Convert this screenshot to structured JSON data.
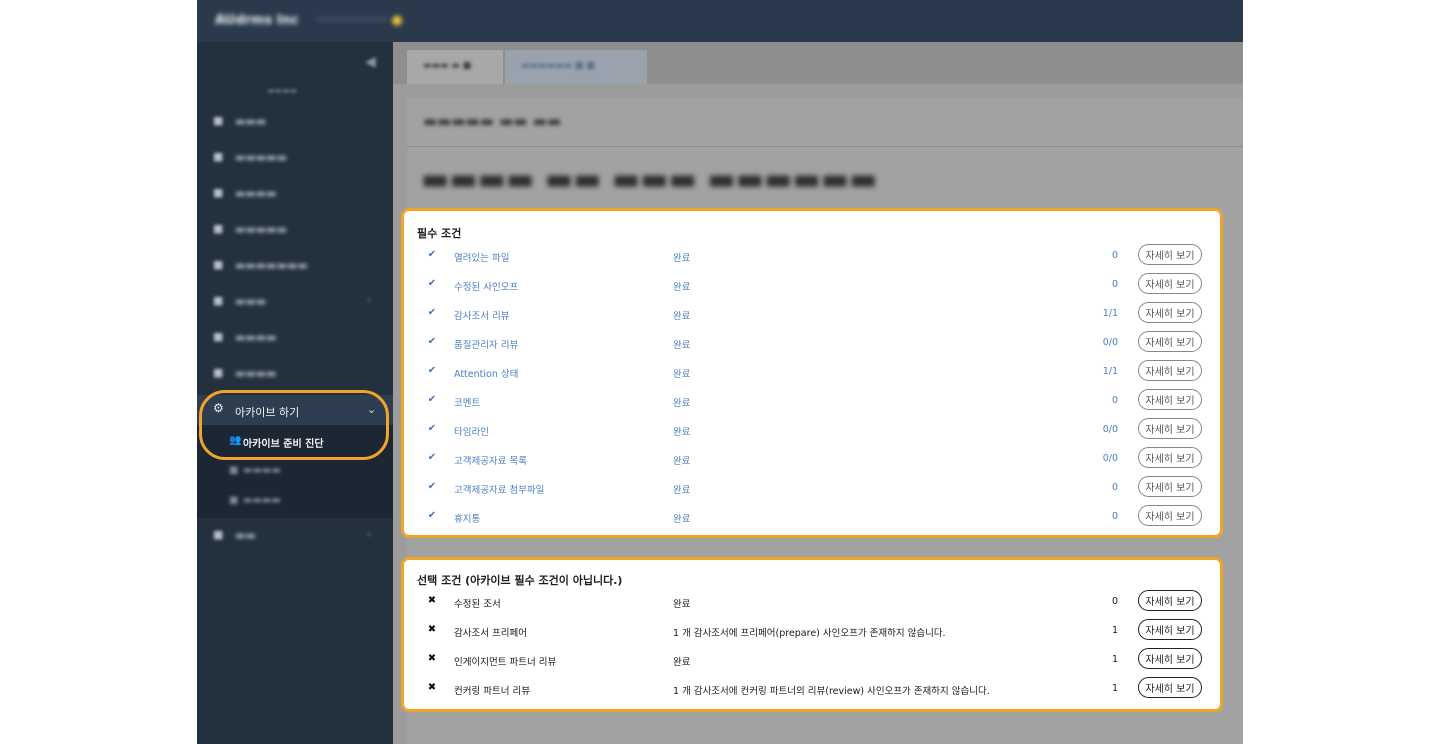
{
  "sidebar": {
    "active_menu": {
      "icon": "gear-icon",
      "label": "아카이브 하기"
    },
    "active_sub": {
      "icon": "users-icon",
      "label": "아카이브 준비 진단"
    }
  },
  "required": {
    "title": "필수 조건",
    "detail_label": "자세히 보기",
    "rows": [
      {
        "name": "열려있는 파일",
        "status": "완료",
        "count": "0"
      },
      {
        "name": "수정된 사인오프",
        "status": "완료",
        "count": "0"
      },
      {
        "name": "감사조서 리뷰",
        "status": "완료",
        "count": "1/1"
      },
      {
        "name": "품질관리자 리뷰",
        "status": "완료",
        "count": "0/0"
      },
      {
        "name": "Attention 상태",
        "status": "완료",
        "count": "1/1"
      },
      {
        "name": "코멘트",
        "status": "완료",
        "count": "0"
      },
      {
        "name": "타임라인",
        "status": "완료",
        "count": "0/0"
      },
      {
        "name": "고객제공자료 목록",
        "status": "완료",
        "count": "0/0"
      },
      {
        "name": "고객제공자료 첨부파일",
        "status": "완료",
        "count": "0"
      },
      {
        "name": "휴지통",
        "status": "완료",
        "count": "0"
      }
    ]
  },
  "optional": {
    "title": "선택 조건 (아카이브 필수 조건이 아닙니다.)",
    "detail_label": "자세히 보기",
    "rows": [
      {
        "name": "수정된 조서",
        "status": "완료",
        "count": "0"
      },
      {
        "name": "감사조서 프리페어",
        "status": "1 개 감사조서에 프리페어(prepare) 사인오프가 존재하지 않습니다.",
        "count": "1"
      },
      {
        "name": "인게이지먼트 파트너 리뷰",
        "status": "완료",
        "count": "1"
      },
      {
        "name": "컨커링 파트너 리뷰",
        "status": "1 개 감사조서에 컨커링 파트너의 리뷰(review) 사인오프가 존재하지 않습니다.",
        "count": "1"
      }
    ]
  },
  "colors": {
    "highlight": "#f0a52a",
    "link_blue": "#4b7fc2",
    "sidebar_bg": "#23303e",
    "topbar_bg": "#2a3a4c"
  }
}
